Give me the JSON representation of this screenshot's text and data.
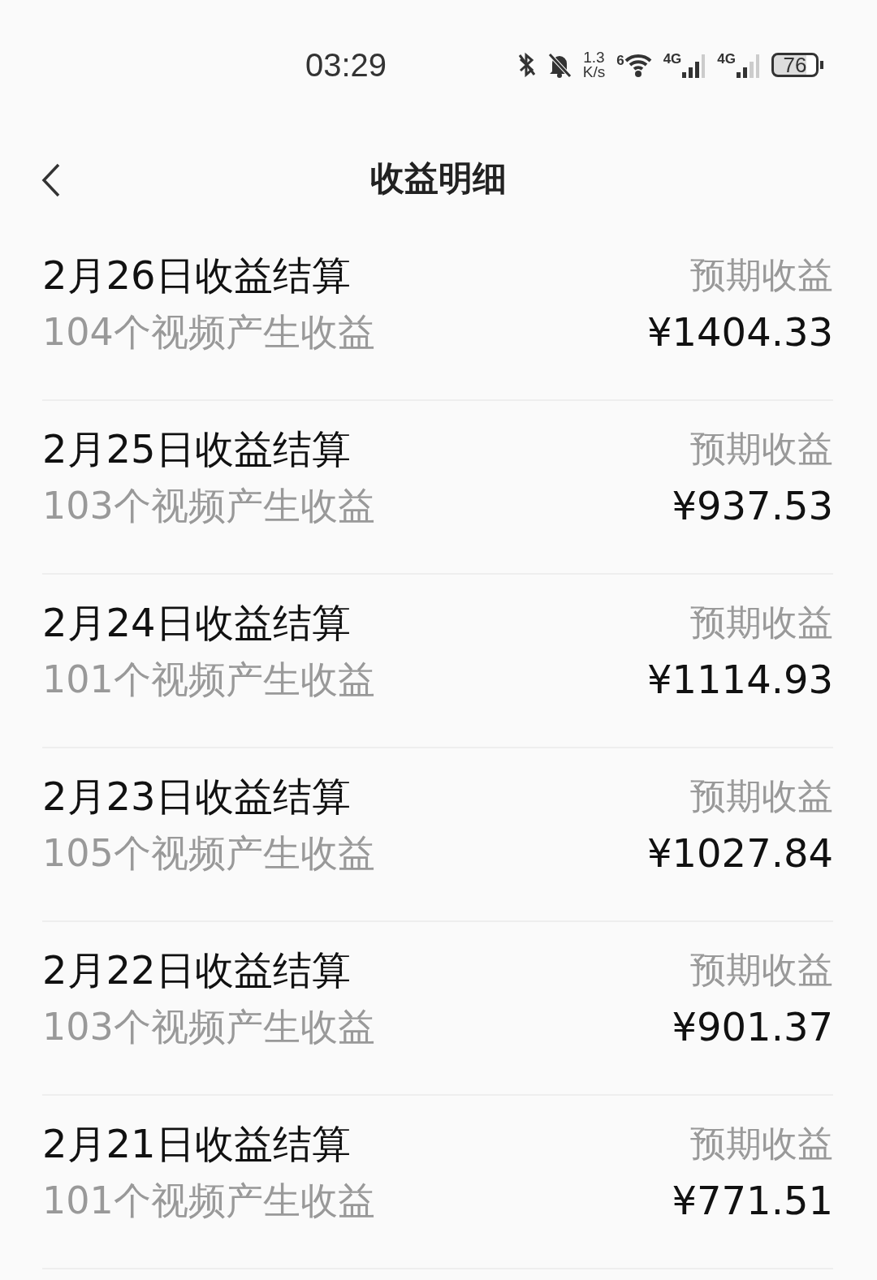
{
  "status_bar": {
    "time": "03:29",
    "net_speed": "1.3",
    "net_unit": "K/s",
    "wifi_label": "6",
    "sim1_label": "4G",
    "sim2_label": "4G",
    "battery": "76"
  },
  "header": {
    "title": "收益明细"
  },
  "rows": [
    {
      "title": "2月26日收益结算",
      "subtitle": "104个视频产生收益",
      "label": "预期收益",
      "amount": "¥1404.33"
    },
    {
      "title": "2月25日收益结算",
      "subtitle": "103个视频产生收益",
      "label": "预期收益",
      "amount": "¥937.53"
    },
    {
      "title": "2月24日收益结算",
      "subtitle": "101个视频产生收益",
      "label": "预期收益",
      "amount": "¥1114.93"
    },
    {
      "title": "2月23日收益结算",
      "subtitle": "105个视频产生收益",
      "label": "预期收益",
      "amount": "¥1027.84"
    },
    {
      "title": "2月22日收益结算",
      "subtitle": "103个视频产生收益",
      "label": "预期收益",
      "amount": "¥901.37"
    },
    {
      "title": "2月21日收益结算",
      "subtitle": "101个视频产生收益",
      "label": "预期收益",
      "amount": "¥771.51"
    }
  ]
}
